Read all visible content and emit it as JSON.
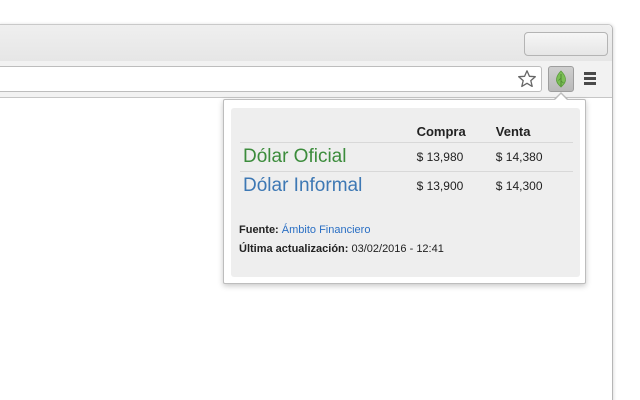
{
  "browser": {
    "omnibox": {
      "value": ""
    },
    "extension": {
      "icon": "leaf-icon",
      "accent": "#7bbf55"
    },
    "menu": {
      "icon": "hamburger-menu-icon"
    }
  },
  "popup": {
    "columns": {
      "compra": "Compra",
      "venta": "Venta"
    },
    "rows": [
      {
        "name": "Dólar Oficial",
        "compra": "$ 13,980",
        "venta": "$ 14,380",
        "color": "#3c8c3c"
      },
      {
        "name": "Dólar Informal",
        "compra": "$ 13,900",
        "venta": "$ 14,300",
        "color": "#3d78b4"
      }
    ],
    "source_label": "Fuente:",
    "source_link": "Ámbito Financiero",
    "updated_label": "Última actualización:",
    "updated_value": "03/02/2016 - 12:41",
    "link_color": "#2a6fc4"
  }
}
